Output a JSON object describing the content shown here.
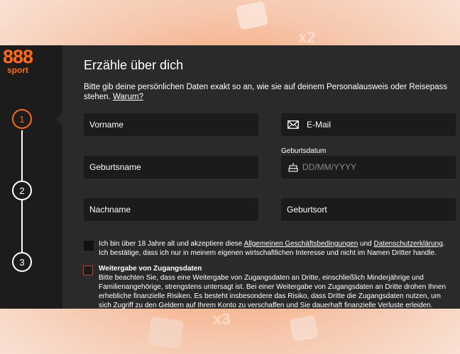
{
  "brand": {
    "logo_number": "888",
    "logo_word": "sport",
    "accent": "#ff6a13"
  },
  "background": {
    "deco_text_1": "x2",
    "deco_text_2": "x3"
  },
  "steps": [
    {
      "number": "1",
      "state": "active"
    },
    {
      "number": "2",
      "state": "inactive"
    },
    {
      "number": "3",
      "state": "inactive"
    }
  ],
  "form": {
    "title": "Erzähle über dich",
    "intro": "Bitte gib deine persönlichen Daten exakt so an, wie sie auf deinem Personalausweis oder Reisepass stehen.",
    "intro_link": "Warum?",
    "fields": {
      "vorname": "Vorname",
      "email": "E-Mail",
      "geburtsname": "Geburtsname",
      "birthdate_label": "Geburtsdatum",
      "birthdate_placeholder": "DD/MM/YYYY",
      "nachname": "Nachname",
      "geburtsort": "Geburtsort"
    },
    "consent": {
      "text_before": "Ich bin über 18 Jahre alt und akzeptiere diese",
      "link_terms": "Allgemeinen Geschäftsbedingungen",
      "and": "und",
      "link_privacy": "Datenschutzerklärung",
      "text_after": ". Ich bestätige, dass ich nur in meinem eigenen wirtschaftlichen Interesse und nicht im Namen Dritter handle."
    },
    "credentials": {
      "title": "Weitergabe von Zugangsdaten",
      "body": "Bitte beachten Sie, dass eine Weitergabe von Zugangsdaten an Dritte, einschließlich Minderjährige und Familienangehörige, strengstens untersagt ist. Bei einer Weitergabe von Zugangsdaten an Dritte drohen Ihnen erhebliche finanzielle Risiken. Es besteht insbesondere das Risiko, dass Dritte die Zugangsdaten nutzen, um sich Zugriff zu den Geldern auf Ihrem Konto zu verschaffen und Sie dauerhaft finanzielle Verluste erleiden."
    }
  }
}
